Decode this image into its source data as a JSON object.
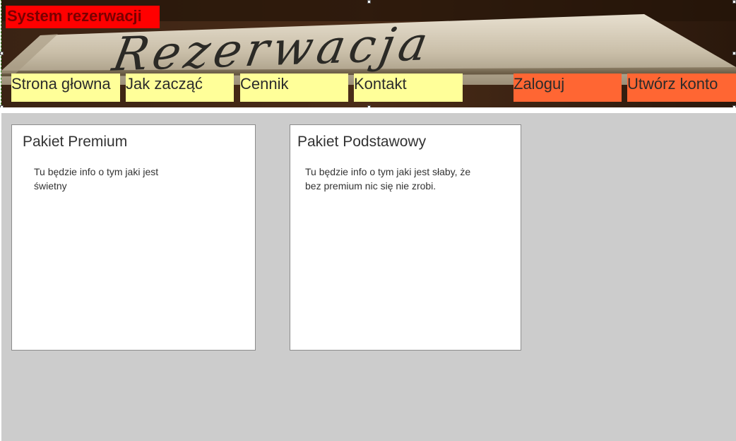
{
  "header": {
    "site_title": "System rezerwacji",
    "banner_text": "Rezerwacja",
    "nav": {
      "home": "Strona głowna",
      "getting_started": "Jak zacząć",
      "pricing": "Cennik",
      "contact": "Kontakt",
      "login": "Zaloguj",
      "register": "Utwórz konto"
    }
  },
  "packages": [
    {
      "title": "Pakiet Premium",
      "description": "Tu będzie info o tym jaki jest świetny"
    },
    {
      "title": "Pakiet Podstawowy",
      "description": "Tu będzie info o tym jaki jest słaby, że bez premium nic się nie zrobi."
    }
  ],
  "colors": {
    "title_bg": "#ff0000",
    "nav_bg": "#ffff99",
    "account_bg": "#ff6633",
    "content_bg": "#cccccc",
    "card_bg": "#ffffff"
  }
}
